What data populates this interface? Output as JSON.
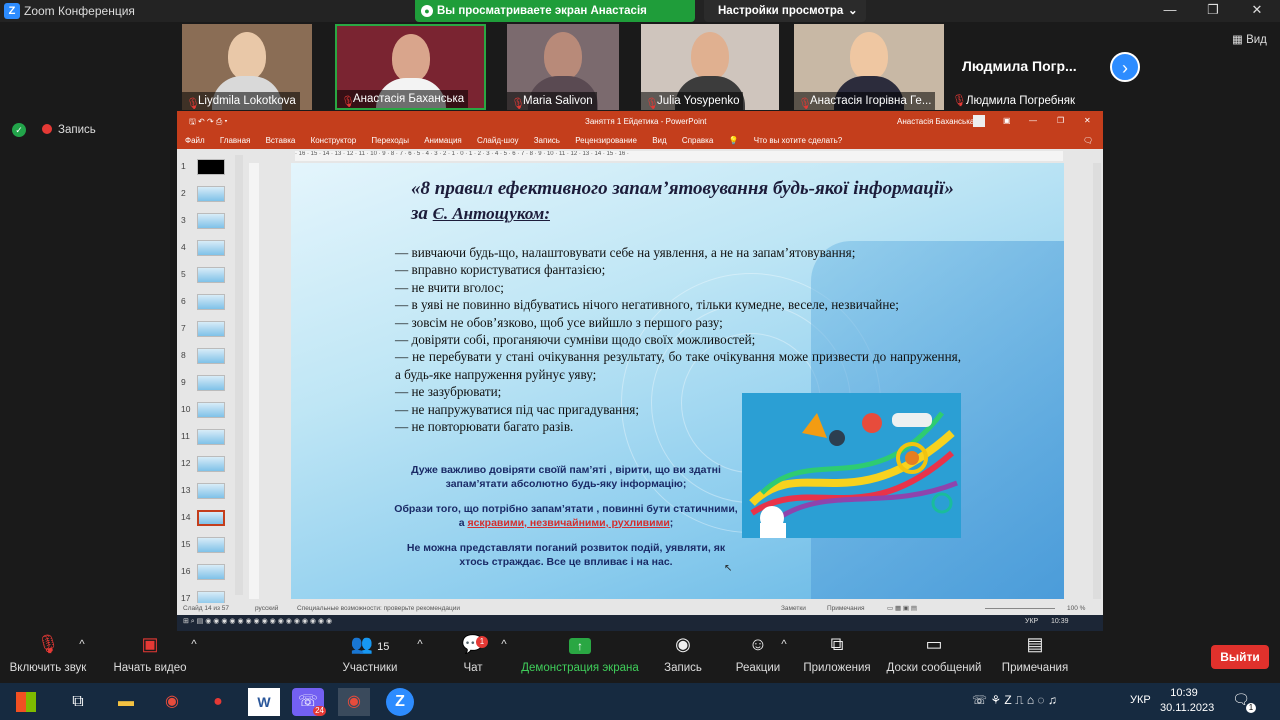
{
  "zoom": {
    "title": "Zoom Конференция",
    "share_banner": "Вы просматриваете экран Анастасія Баханська",
    "view_settings": "Настройки просмотра",
    "view_label": "Вид",
    "recording_label": "Запись",
    "participants": [
      {
        "name": "Liydmila Lokotkova"
      },
      {
        "name": "Анастасія Баханська"
      },
      {
        "name": "Maria Salivon"
      },
      {
        "name": "Julia Yosypenko"
      },
      {
        "name": "Анастасія Ігорівна Ге..."
      },
      {
        "name": "Людмила Погребняк"
      }
    ],
    "more_name": "Людмила  Погр...",
    "controls": {
      "mute": "Включить звук",
      "video": "Начать видео",
      "participants": "Участники",
      "participants_count": "15",
      "chat": "Чат",
      "chat_badge": "1",
      "share": "Демонстрация экрана",
      "record": "Запись",
      "reactions": "Реакции",
      "apps": "Приложения",
      "whiteboards": "Доски сообщений",
      "notes": "Примечания",
      "exit": "Выйти"
    }
  },
  "ppt": {
    "title": "Заняття 1 Ейдетика  -  PowerPoint",
    "user": "Анастасія Баханська",
    "menu": [
      "Файл",
      "Главная",
      "Вставка",
      "Конструктор",
      "Переходы",
      "Анимация",
      "Слайд-шоу",
      "Запись",
      "Рецензирование",
      "Вид",
      "Справка"
    ],
    "tell_me": "Что вы хотите сделать?",
    "slide_numbers": [
      "1",
      "2",
      "3",
      "4",
      "5",
      "6",
      "7",
      "8",
      "9",
      "10",
      "11",
      "12",
      "13",
      "14",
      "15",
      "16",
      "17"
    ],
    "active_slide": 14,
    "status_left": "Слайд 14 из 57",
    "status_lang": "русский",
    "status_access": "Специальные возможности: проверьте рекомендации",
    "status_notes": "Заметки",
    "status_comments": "Примечания",
    "zoom_level": "100 %",
    "slide": {
      "title_1": "«8 правил ефективного запам’ятовування будь-якої інформації» за",
      "title_2": "Є. Антощуком:",
      "rules": [
        "— вивчаючи будь-що, налаштовувати себе на уявлення, а не на запам’ятовування;",
        "— вправно користуватися фантазією;",
        "— не вчити вголос;",
        "— в уяві не повинно відбуватись нічого негативного, тільки кумедне, веселе, незвичайне;",
        "— зовсім не обов’язково, щоб усе вийшло з першого разу;",
        "— довіряти собі, проганяючи сумніви щодо своїх можливостей;",
        "— не перебувати у стані очікування результату, бо таке очікування може призвести до напруження, а будь-яке напруження руйнує уяву;",
        "— не зазубрювати;",
        "— не напружуватися під час пригадування;",
        "— не повторювати багато разів."
      ],
      "note_1": "Дуже важливо довіряти своїй пам’яті , вірити, що ви здатні запам’ятати абсолютно будь-яку інформацію;",
      "note_2a": "Образи того, що потрібно запам’ятати , повинні бути статичними, а ",
      "note_2b": "яскравими, незвичайними, рухливими",
      "note_2c": ";",
      "note_3": "Не можна представляти поганий розвиток подій, уявляти, як хтось страждає. Все це впливає і на нас."
    },
    "taskbar_lang": "УКР",
    "taskbar_time": "10:39"
  },
  "windows": {
    "lang": "УКР",
    "time": "10:39",
    "date": "30.11.2023",
    "notif_count": "1",
    "viber_badge": "24"
  }
}
